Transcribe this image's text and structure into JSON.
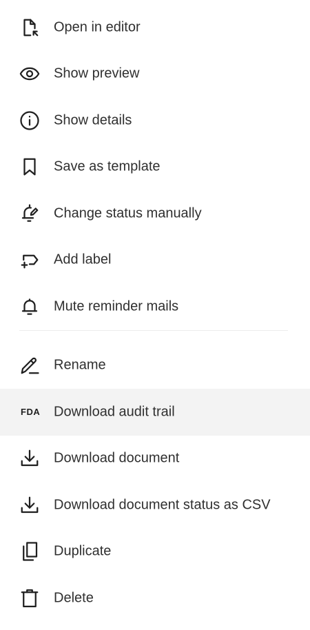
{
  "menu": {
    "items": [
      {
        "label": "Open in editor",
        "icon": "open-in-editor-icon"
      },
      {
        "label": "Show preview",
        "icon": "eye-icon"
      },
      {
        "label": "Show details",
        "icon": "info-icon"
      },
      {
        "label": "Save as template",
        "icon": "bookmark-icon"
      },
      {
        "label": "Change status manually",
        "icon": "status-change-icon"
      },
      {
        "label": "Add label",
        "icon": "add-label-icon"
      },
      {
        "label": "Mute reminder mails",
        "icon": "bell-icon"
      },
      {
        "label": "Rename",
        "icon": "pencil-icon"
      },
      {
        "label": "Download audit trail",
        "icon": "fda-icon",
        "icon_text": "FDA"
      },
      {
        "label": "Download document",
        "icon": "download-icon"
      },
      {
        "label": "Download document status as CSV",
        "icon": "download-icon"
      },
      {
        "label": "Duplicate",
        "icon": "duplicate-icon"
      },
      {
        "label": "Delete",
        "icon": "trash-icon"
      }
    ],
    "highlighted_item": "Download audit trail",
    "highlight_color": "#f3f3f3"
  }
}
